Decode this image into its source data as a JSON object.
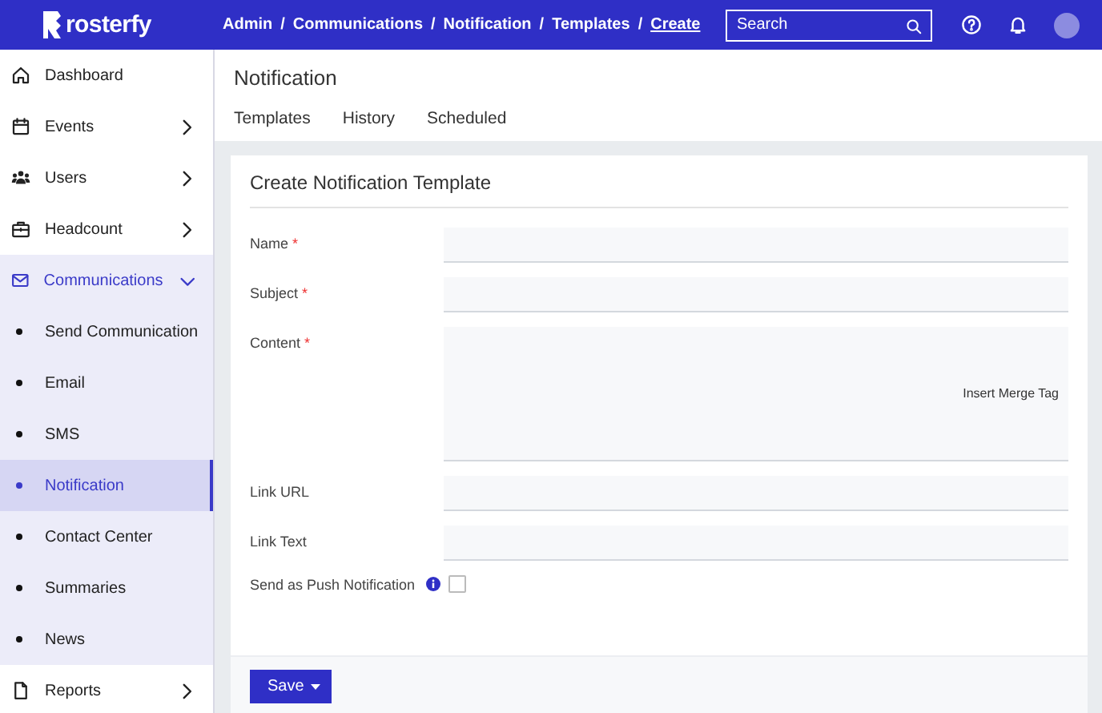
{
  "header": {
    "logo": "rosterfy",
    "breadcrumbs": [
      {
        "label": "Admin",
        "current": false
      },
      {
        "label": "Communications",
        "current": false
      },
      {
        "label": "Notification",
        "current": false
      },
      {
        "label": "Templates",
        "current": false
      },
      {
        "label": "Create",
        "current": true
      }
    ],
    "separator": "/",
    "search": {
      "placeholder": "Search"
    }
  },
  "sidebar": {
    "items": [
      {
        "label": "Dashboard",
        "expandable": false,
        "expanded": false,
        "selected": false
      },
      {
        "label": "Events",
        "expandable": true,
        "expanded": false,
        "selected": false
      },
      {
        "label": "Users",
        "expandable": true,
        "expanded": false,
        "selected": false
      },
      {
        "label": "Headcount",
        "expandable": true,
        "expanded": false,
        "selected": false
      },
      {
        "label": "Communications",
        "expandable": true,
        "expanded": true,
        "selected": false,
        "children": [
          {
            "label": "Send Communication",
            "selected": false
          },
          {
            "label": "Email",
            "selected": false
          },
          {
            "label": "SMS",
            "selected": false
          },
          {
            "label": "Notification",
            "selected": true
          },
          {
            "label": "Contact Center",
            "selected": false
          },
          {
            "label": "Summaries",
            "selected": false
          },
          {
            "label": "News",
            "selected": false
          }
        ]
      },
      {
        "label": "Reports",
        "expandable": true,
        "expanded": false,
        "selected": false
      }
    ]
  },
  "page": {
    "title": "Notification",
    "tabs": [
      "Templates",
      "History",
      "Scheduled"
    ]
  },
  "form": {
    "title": "Create Notification Template",
    "fields": [
      {
        "kind": "input",
        "label": "Name",
        "required_mark": "*"
      },
      {
        "kind": "input",
        "label": "Subject",
        "required_mark": "*"
      },
      {
        "kind": "textarea",
        "label": "Content",
        "required_mark": "*",
        "action": "Insert Merge Tag"
      },
      {
        "kind": "input",
        "label": "Link URL"
      },
      {
        "kind": "input",
        "label": "Link Text"
      },
      {
        "kind": "checkbox",
        "label": "Send as Push Notification",
        "info": true,
        "checked": false
      }
    ],
    "save_button": "Save"
  }
}
